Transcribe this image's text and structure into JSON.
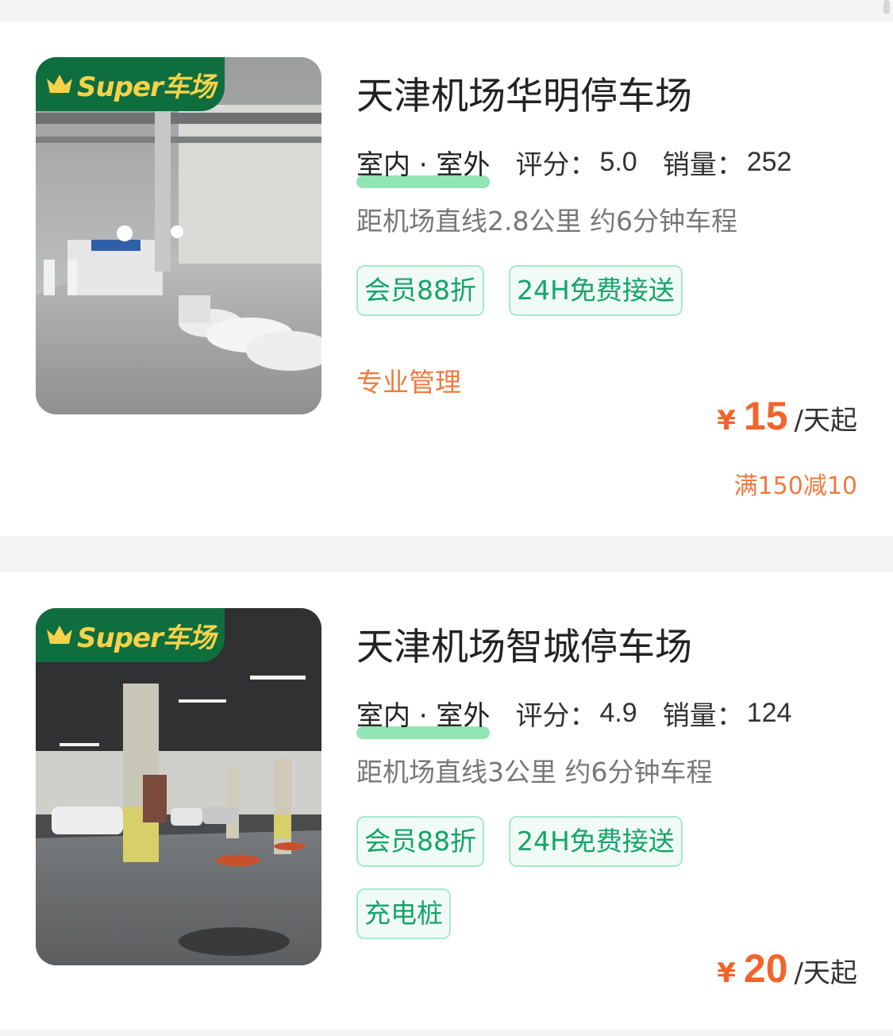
{
  "listings": [
    {
      "badge": "Super车场",
      "name": "天津机场华明停车场",
      "type": "室内 · 室外",
      "rating_label": "评分：",
      "rating": "5.0",
      "sales_label": "销量：",
      "sales": "252",
      "distance": "距机场直线2.8公里 约6分钟车程",
      "tags": [
        "会员88折",
        "24H免费接送"
      ],
      "feature": "专业管理",
      "currency": "¥",
      "price": "15",
      "price_unit": "/天起",
      "discount": "满150减10"
    },
    {
      "badge": "Super车场",
      "name": "天津机场智城停车场",
      "type": "室内 · 室外",
      "rating_label": "评分：",
      "rating": "4.9",
      "sales_label": "销量：",
      "sales": "124",
      "distance": "距机场直线3公里 约6分钟车程",
      "tags": [
        "会员88折",
        "24H免费接送",
        "充电桩"
      ],
      "currency": "¥",
      "price": "20",
      "price_unit": "/天起"
    }
  ],
  "colors": {
    "badge_bg": "#0f6e3e",
    "badge_text": "#f6d24a",
    "tag_text": "#16a36b",
    "tag_border": "#a9e8cc",
    "price": "#f3642a",
    "highlight": "#7fe0a8"
  },
  "icons": {
    "badge_icon": "crown-icon"
  }
}
